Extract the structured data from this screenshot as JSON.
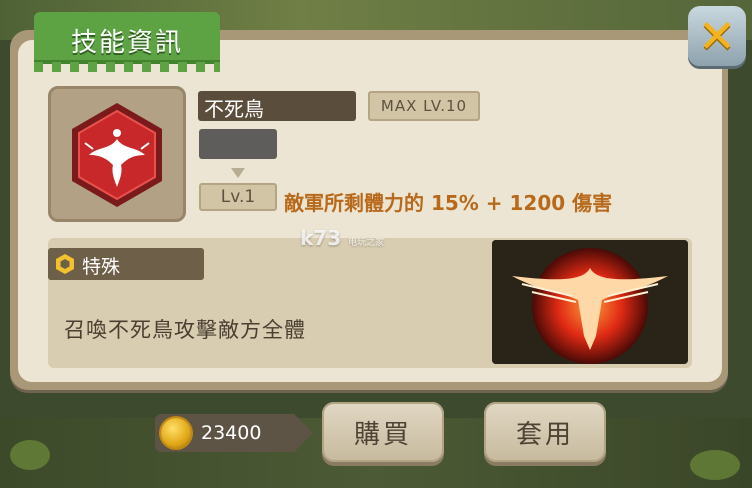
{
  "title": "技能資訊",
  "skill": {
    "name": "不死鳥",
    "max_level": "MAX LV.10",
    "level": "Lv.1",
    "effect": "敵軍所剩體力的 15% + 1200 傷害",
    "type": "特殊",
    "description": "召喚不死鳥攻擊敵方全體",
    "icon": "phoenix-emblem-icon"
  },
  "price": "23400",
  "buttons": {
    "buy": "購買",
    "apply": "套用"
  },
  "watermark": {
    "main": "k73",
    "sub": "电玩之家"
  },
  "colors": {
    "title_tab": "#5da344",
    "effect_text": "#b86a1c",
    "close": "#f3b321"
  }
}
